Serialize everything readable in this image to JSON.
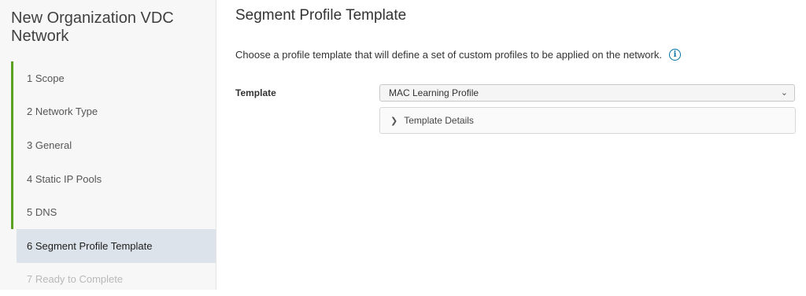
{
  "wizard": {
    "title": "New Organization VDC Network",
    "steps": [
      {
        "label": "1  Scope",
        "state": "complete"
      },
      {
        "label": "2  Network Type",
        "state": "complete"
      },
      {
        "label": "3  General",
        "state": "complete"
      },
      {
        "label": "4  Static IP Pools",
        "state": "complete"
      },
      {
        "label": "5  DNS",
        "state": "complete"
      },
      {
        "label": "6  Segment Profile Template",
        "state": "current"
      },
      {
        "label": "7  Ready to Complete",
        "state": "disabled"
      }
    ]
  },
  "main": {
    "title": "Segment Profile Template",
    "description": "Choose a profile template that will define a set of custom profiles to be applied on the network.",
    "info_icon": "info-icon",
    "template_label": "Template",
    "template_value": "MAC Learning Profile",
    "details_label": "Template Details"
  },
  "colors": {
    "step_bar": "#5aa220",
    "current_step_bg": "#dde3ea",
    "info_blue": "#0072a3"
  }
}
